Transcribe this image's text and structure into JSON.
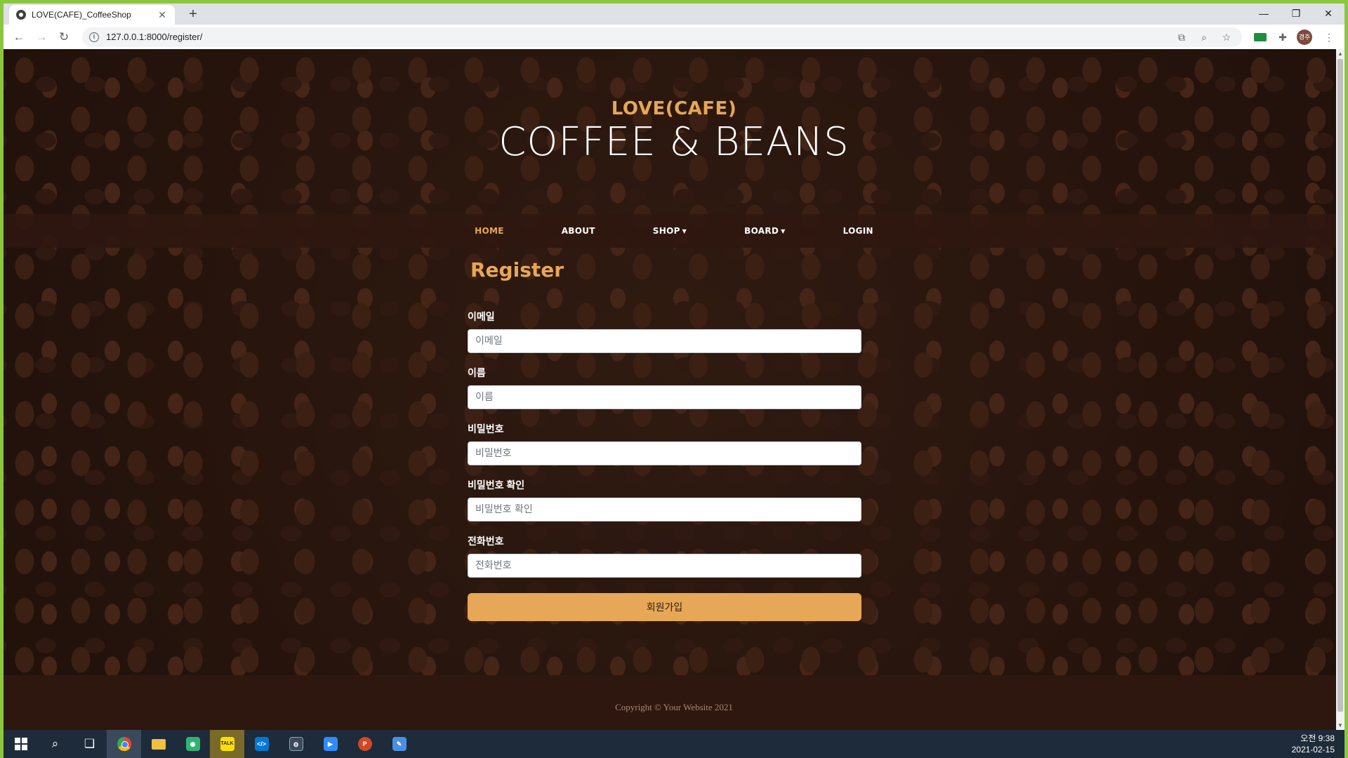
{
  "browser": {
    "tab_title": "LOVE(CAFE)_CoffeeShop",
    "tab_close": "✕",
    "new_tab": "+",
    "url": "127.0.0.1:8000/register/",
    "window_controls": [
      "—",
      "❐",
      "✕"
    ]
  },
  "site": {
    "heading_upper": "LOVE(CAFE)",
    "heading_lower": "COFFEE & BEANS",
    "nav": [
      {
        "label": "HOME",
        "active": true
      },
      {
        "label": "ABOUT"
      },
      {
        "label": "SHOP",
        "dropdown": true
      },
      {
        "label": "BOARD",
        "dropdown": true
      },
      {
        "label": "LOGIN"
      }
    ],
    "accent_color": "#e6a756"
  },
  "form": {
    "title": "Register",
    "fields": [
      {
        "label": "이메일",
        "placeholder": "이메일"
      },
      {
        "label": "이름",
        "placeholder": "이름"
      },
      {
        "label": "비밀번호",
        "placeholder": "비밀번호"
      },
      {
        "label": "비밀번호 확인",
        "placeholder": "비밀번호 확인"
      },
      {
        "label": "전화번호",
        "placeholder": "전화번호"
      }
    ],
    "submit_label": "회원가입"
  },
  "footer": {
    "copyright": "Copyright © Your Website 2021"
  },
  "system": {
    "profile_initials": "경주",
    "time": "오전 9:38",
    "date": "2021-02-15",
    "taskbar_apps": [
      "start",
      "search",
      "task-view",
      "chrome",
      "file-explorer",
      "kakao-map",
      "kakaotalk",
      "vscode",
      "app",
      "zoom",
      "powerpoint",
      "app-2"
    ]
  }
}
